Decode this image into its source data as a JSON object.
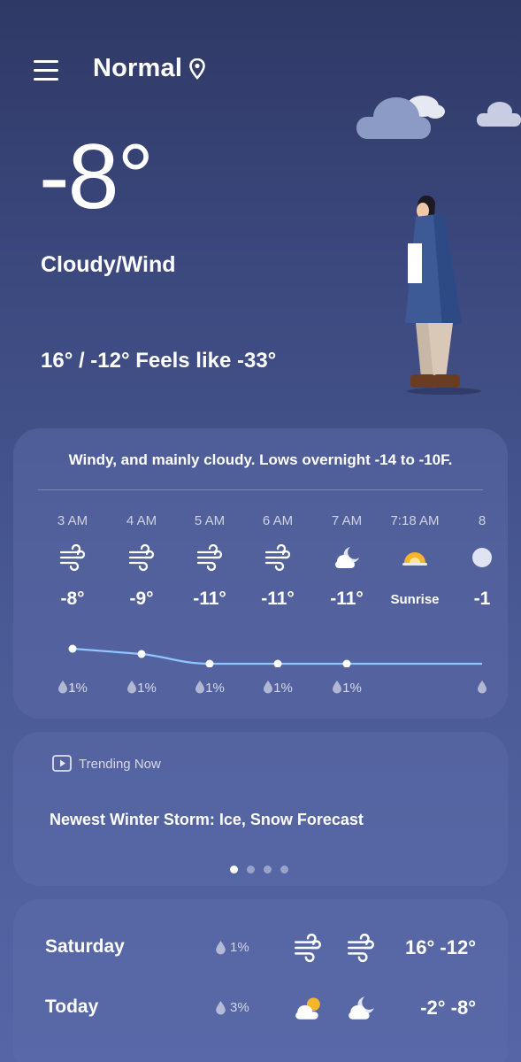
{
  "header": {
    "location": "Normal",
    "menu_icon": "hamburger-menu-icon",
    "location_icon": "map-pin-icon"
  },
  "current": {
    "temperature": "-8°",
    "condition": "Cloudy/Wind",
    "high_low_feels": "16° / -12° Feels like -33°"
  },
  "hourly": {
    "summary": "Windy, and mainly cloudy. Lows overnight -14 to -10F.",
    "items": [
      {
        "time": "3 AM",
        "icon": "wind-icon",
        "temp": "-8°",
        "precip": "1%",
        "value": -8
      },
      {
        "time": "4 AM",
        "icon": "wind-icon",
        "temp": "-9°",
        "precip": "1%",
        "value": -9
      },
      {
        "time": "5 AM",
        "icon": "wind-icon",
        "temp": "-11°",
        "precip": "1%",
        "value": -11
      },
      {
        "time": "6 AM",
        "icon": "wind-icon",
        "temp": "-11°",
        "precip": "1%",
        "value": -11
      },
      {
        "time": "7 AM",
        "icon": "cloudy-night-icon",
        "temp": "-11°",
        "precip": "1%",
        "value": -11
      },
      {
        "time": "7:18 AM",
        "icon": "sunrise-icon",
        "temp": "Sunrise",
        "precip": ""
      },
      {
        "time": "8",
        "icon": "partial-moon-icon",
        "temp": "-1",
        "precip": ""
      }
    ]
  },
  "trending": {
    "label": "Trending Now",
    "icon": "play-icon",
    "headline": "Newest Winter Storm: Ice, Snow Forecast",
    "pages": 4,
    "active_page": 1
  },
  "daily": [
    {
      "day": "Saturday",
      "precip": "1%",
      "day_icon": "wind-icon",
      "night_icon": "wind-icon",
      "temps": "16° -12°"
    },
    {
      "day": "Today",
      "precip": "3%",
      "day_icon": "partly-cloudy-day-icon",
      "night_icon": "cloudy-night-icon",
      "temps": "-2° -8°"
    }
  ],
  "colors": {
    "background_top": "#2f3966",
    "background_bottom": "#5466a6",
    "temp_line": "#8fc6ff",
    "sun": "#f7b52b"
  }
}
